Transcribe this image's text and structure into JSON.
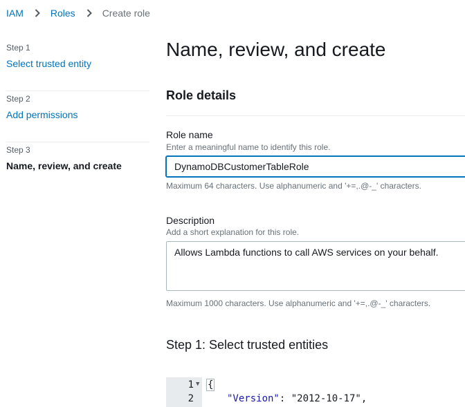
{
  "breadcrumb": {
    "items": [
      "IAM",
      "Roles"
    ],
    "current": "Create role"
  },
  "steps": [
    {
      "number": "Step 1",
      "label": "Select trusted entity"
    },
    {
      "number": "Step 2",
      "label": "Add permissions"
    },
    {
      "number": "Step 3",
      "label": "Name, review, and create"
    }
  ],
  "page": {
    "title": "Name, review, and create",
    "section_title": "Role details"
  },
  "role_name": {
    "label": "Role name",
    "description": "Enter a meaningful name to identify this role.",
    "value": "DynamoDBCustomerTableRole",
    "constraint": "Maximum 64 characters. Use alphanumeric and '+=,.@-_' characters."
  },
  "description_field": {
    "label": "Description",
    "description": "Add a short explanation for this role.",
    "value": "Allows Lambda functions to call AWS services on your behalf.",
    "constraint": "Maximum 1000 characters. Use alphanumeric and '+=,.@-_' characters."
  },
  "trusted_entities": {
    "title": "Step 1: Select trusted entities",
    "code_lines": [
      {
        "number": "1",
        "text": "{"
      },
      {
        "number": "2",
        "key": "\"Version\"",
        "sep": ": ",
        "value": "\"2012-10-17\"",
        "end": ","
      }
    ]
  },
  "colors": {
    "link": "#0073bb",
    "focus_border": "#0073bb",
    "muted": "#687078",
    "gutter": "#e8ebed"
  },
  "icons": {
    "breadcrumb_separator": "chevron-right-icon",
    "fold": "caret-down-icon"
  }
}
